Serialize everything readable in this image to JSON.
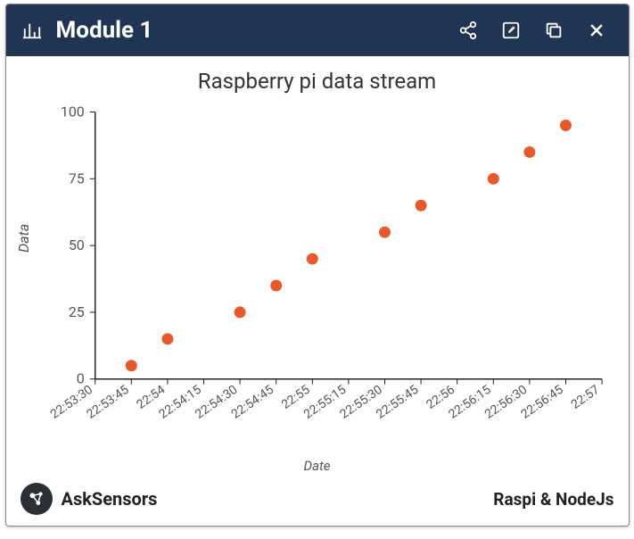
{
  "header": {
    "title": "Module 1"
  },
  "footer": {
    "brand": "AskSensors",
    "source": "Raspi & NodeJs"
  },
  "chart_data": {
    "type": "scatter",
    "title": "Raspberry pi data stream",
    "xlabel": "Date",
    "ylabel": "Data",
    "ylim": [
      0,
      100
    ],
    "yticks": [
      0,
      25,
      50,
      75,
      100
    ],
    "xticks": [
      "22:53:30",
      "22:53:45",
      "22:54",
      "22:54:15",
      "22:54:30",
      "22:54:45",
      "22:55",
      "22:55:15",
      "22:55:30",
      "22:55:45",
      "22:56",
      "22:56:15",
      "22:56:30",
      "22:56:45",
      "22:57"
    ],
    "x": [
      "22:53:45",
      "22:54",
      "22:54:30",
      "22:54:45",
      "22:55",
      "22:55:30",
      "22:55:45",
      "22:56:15",
      "22:56:30",
      "22:56:45"
    ],
    "values": [
      5,
      15,
      25,
      35,
      45,
      55,
      65,
      75,
      85,
      95
    ],
    "point_color": "#e8592a"
  }
}
